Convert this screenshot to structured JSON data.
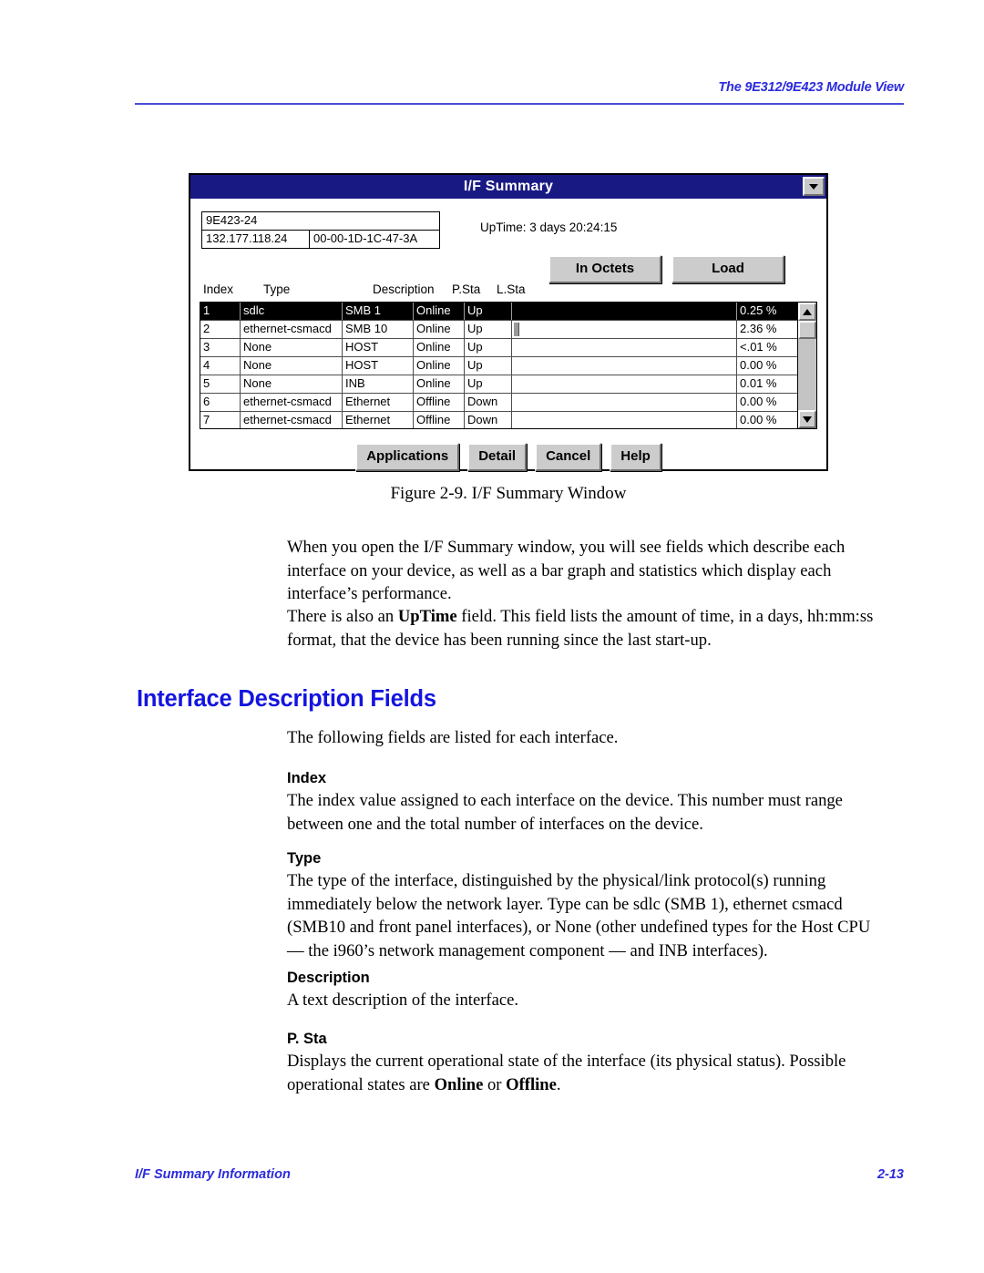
{
  "page": {
    "running_head": "The 9E312/9E423 Module View",
    "footer_left": "I/F Summary Information",
    "footer_right": "2-13",
    "accent_color": "#2b2bdd",
    "heading_color": "#1414e0",
    "titlebar_color": "#191984"
  },
  "figure": {
    "caption": "Figure 2-9.  I/F Summary Window",
    "dialog": {
      "title": "I/F Summary",
      "sysmenu_icon": "chevron-down-icon",
      "device": {
        "name": "9E423-24",
        "ip_address": "132.177.118.24",
        "mac_address": "00-00-1D-1C-47-3A"
      },
      "uptime_label": "UpTime: 3 days 20:24:15",
      "top_buttons": [
        {
          "label": "In Octets"
        },
        {
          "label": "Load"
        }
      ],
      "columns": [
        "Index",
        "Type",
        "Description",
        "P.Sta",
        "L.Sta"
      ],
      "rows": [
        {
          "index": "1",
          "type": "sdlc",
          "description": "SMB 1",
          "p_sta": "Online",
          "l_sta": "Up",
          "percent": "0.25 %",
          "bar_pct": 0,
          "selected": true
        },
        {
          "index": "2",
          "type": "ethernet-csmacd",
          "description": "SMB 10",
          "p_sta": "Online",
          "l_sta": "Up",
          "percent": "2.36 %",
          "bar_pct": 2.4,
          "selected": false
        },
        {
          "index": "3",
          "type": "None",
          "description": "HOST",
          "p_sta": "Online",
          "l_sta": "Up",
          "percent": "<.01 %",
          "bar_pct": 0,
          "selected": false
        },
        {
          "index": "4",
          "type": "None",
          "description": "HOST",
          "p_sta": "Online",
          "l_sta": "Up",
          "percent": "0.00 %",
          "bar_pct": 0,
          "selected": false
        },
        {
          "index": "5",
          "type": "None",
          "description": "INB",
          "p_sta": "Online",
          "l_sta": "Up",
          "percent": "0.01 %",
          "bar_pct": 0,
          "selected": false
        },
        {
          "index": "6",
          "type": "ethernet-csmacd",
          "description": "Ethernet",
          "p_sta": "Offline",
          "l_sta": "Down",
          "percent": "0.00 %",
          "bar_pct": 0,
          "selected": false
        },
        {
          "index": "7",
          "type": "ethernet-csmacd",
          "description": "Ethernet",
          "p_sta": "Offline",
          "l_sta": "Down",
          "percent": "0.00 %",
          "bar_pct": 0,
          "selected": false
        }
      ],
      "scrollbar": {
        "up_icon": "arrow-up-icon",
        "down_icon": "arrow-down-icon"
      },
      "bottom_buttons": [
        {
          "label": "Applications"
        },
        {
          "label": "Detail"
        },
        {
          "label": "Cancel"
        },
        {
          "label": "Help"
        }
      ]
    }
  },
  "content": {
    "para_1": "When you open the I/F Summary window, you will see fields which describe each interface on your device, as well as a bar graph and statistics which display each interface’s performance.",
    "para_2_lead": "There is also an ",
    "para_2_bold": "UpTime",
    "para_2_tail": " field. This field lists the amount of time, in a days, hh:mm:ss format, that the device has been running since the last start-up.",
    "section_heading": "Interface Description Fields",
    "intro": "The following fields are listed for each interface.",
    "fields": {
      "index": {
        "name": "Index",
        "text": "The index value assigned to each interface on the device. This number must range between one and the total number of interfaces on the device."
      },
      "type": {
        "name": "Type",
        "text": "The type of the interface, distinguished by the physical/link protocol(s) running immediately below the network layer. Type can be sdlc (SMB 1), ethernet csmacd (SMB10 and front panel interfaces), or None (other undefined types for the Host CPU — the i960’s network management component — and INB interfaces)."
      },
      "description": {
        "name": "Description",
        "text": "A text description of the interface."
      },
      "p_sta": {
        "name": "P. Sta",
        "text_lead": "Displays the current operational state of the interface (its physical status). Possible operational states are ",
        "bold_1": "Online",
        "text_mid": " or ",
        "bold_2": "Offline",
        "text_tail": "."
      }
    }
  }
}
